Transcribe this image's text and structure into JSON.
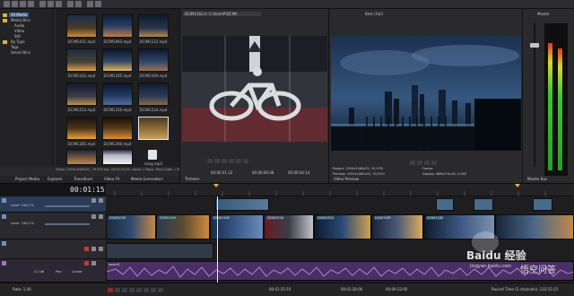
{
  "explorer": {
    "tree": [
      "All Media",
      "Media Bins",
      "Audio",
      "Video",
      "Still",
      "By Type",
      "Tags",
      "Smart Bins"
    ],
    "thumbnails": [
      "DCIM1031.mp4",
      "DCIM1093.mp4",
      "DCIM1122.mp4",
      "DCIM1161.mp4",
      "DCIM1165.mp4",
      "DCIM1169.mp4",
      "DCIM1253.mp4",
      "DCIM1320.mp4",
      "DCIM1234.mp4",
      "DCIM1385.mp4",
      "DCIM1390.mp4",
      "",
      "DCIM1175.mp4",
      "DCIM1180.mp4",
      "",
      "",
      "",
      "song.mp3"
    ],
    "status": "Video: 1920x1080x32, 29,970 fps, 00:00:10;01, Alpha = None, Field Order = None"
  },
  "trimmer": {
    "file": "DCIM1163.mov",
    "path": "C:\\User\\P\\DCIM\\"
  },
  "preview": {
    "mode": "Best (Full)",
    "project": "Project:   1920x1080x32, 29,970i",
    "preview_res": "Preview:   1920x1080x32, 29,970i",
    "frame": "Frame:",
    "display": "Display:   488x274x32, 0,000"
  },
  "master": {
    "label": "Master",
    "bus_label": "Master Bus"
  },
  "tabs": {
    "left": [
      "Project Media",
      "Explorer",
      "Transitions",
      "Video FX",
      "Media Generators"
    ],
    "trimmer": "Trimmer",
    "preview": "Video Preview"
  },
  "timecode": {
    "display": "00:01:15:19",
    "trimmer_in": "00:00:01:22",
    "trimmer_out": "00:00:06:08",
    "trimmer_len": "00:00:04:14",
    "cursor": "00:01:15:19",
    "sel_start": "00:01:30:00",
    "sel_len": "00:00:33:00"
  },
  "tracks": {
    "track1_level": "Level: 100,0 %",
    "track2_level": "Level: 100,0 %",
    "audio_vol": "0,0 dB",
    "audio_pan": "Pan:",
    "audio_center": "Center"
  },
  "clips": {
    "video_labels": [
      "DCIM1035",
      "DCIM1163",
      "DCIM1165",
      "DCIM1234",
      "DCIM1320",
      "DCIM1385",
      "DCIM1180"
    ],
    "audio_label": "sound1"
  },
  "status_bar": {
    "rate": "Rate: 1,00",
    "record_time": "Record Time (2 channels): 132:15:25"
  },
  "watermark": {
    "site": "jingyan.baidu.com",
    "brand": "Baidu 经验",
    "qa": "悟空问答"
  }
}
